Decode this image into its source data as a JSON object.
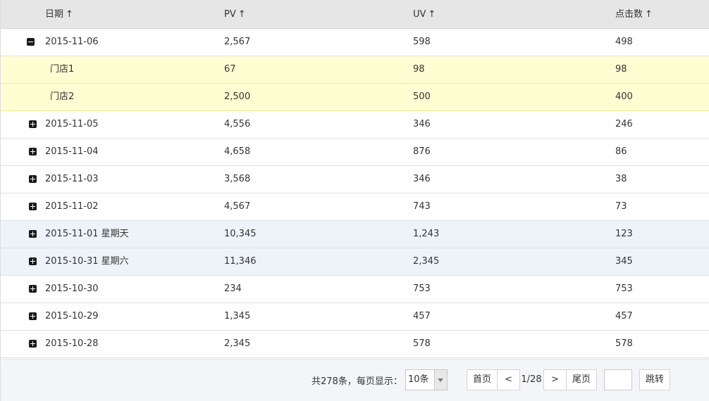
{
  "columns": [
    {
      "label": "日期",
      "sort_icon": "↑"
    },
    {
      "label": "PV",
      "sort_icon": "↑"
    },
    {
      "label": "UV",
      "sort_icon": "↑"
    },
    {
      "label": "点击数",
      "sort_icon": "↑"
    }
  ],
  "rows": [
    {
      "type": "group",
      "expanded": true,
      "date": "2015-11-06",
      "pv": "2,567",
      "uv": "598",
      "clicks": "498"
    },
    {
      "type": "child",
      "date": "门店1",
      "pv": "67",
      "uv": "98",
      "clicks": "98"
    },
    {
      "type": "child",
      "date": "门店2",
      "pv": "2,500",
      "uv": "500",
      "clicks": "400"
    },
    {
      "type": "group",
      "expanded": false,
      "date": "2015-11-05",
      "pv": "4,556",
      "uv": "346",
      "clicks": "246"
    },
    {
      "type": "group",
      "expanded": false,
      "date": "2015-11-04",
      "pv": "4,658",
      "uv": "876",
      "clicks": "86"
    },
    {
      "type": "group",
      "expanded": false,
      "date": "2015-11-03",
      "pv": "3,568",
      "uv": "346",
      "clicks": "38"
    },
    {
      "type": "group",
      "expanded": false,
      "date": "2015-11-02",
      "pv": "4,567",
      "uv": "743",
      "clicks": "73"
    },
    {
      "type": "group",
      "expanded": false,
      "highlight": true,
      "date": "2015-11-01 星期天",
      "pv": "10,345",
      "uv": "1,243",
      "clicks": "123"
    },
    {
      "type": "group",
      "expanded": false,
      "highlight": true,
      "date": "2015-10-31 星期六",
      "pv": "11,346",
      "uv": "2,345",
      "clicks": "345"
    },
    {
      "type": "group",
      "expanded": false,
      "date": "2015-10-30",
      "pv": "234",
      "uv": "753",
      "clicks": "753"
    },
    {
      "type": "group",
      "expanded": false,
      "date": "2015-10-29",
      "pv": "1,345",
      "uv": "457",
      "clicks": "457"
    },
    {
      "type": "group",
      "expanded": false,
      "date": "2015-10-28",
      "pv": "2,345",
      "uv": "578",
      "clicks": "578"
    }
  ],
  "pagination": {
    "total_text": "共278条，每页显示：",
    "page_size": "10条",
    "first": "首页",
    "prev": "<",
    "page_info": "1/28",
    "next": ">",
    "last": "尾页",
    "jump_value": "",
    "jump_label": "跳转"
  },
  "colors": {
    "header_bg": "#e6e6e6",
    "child_row_bg": "#fefed2",
    "weekend_row_bg": "#edf3f8",
    "footer_bg": "#f3f5f8"
  },
  "icons": {
    "expanded": "minus-square-icon",
    "collapsed": "plus-square-icon"
  }
}
